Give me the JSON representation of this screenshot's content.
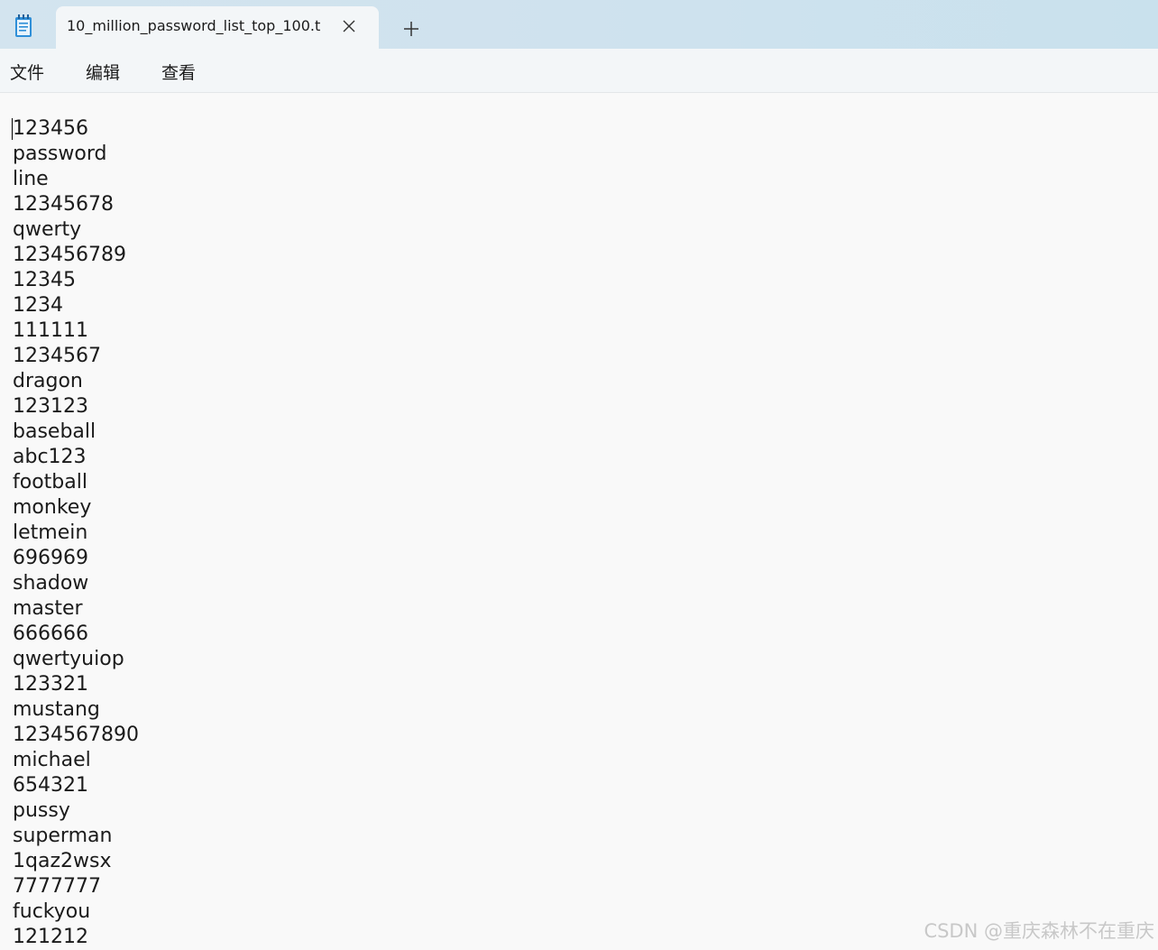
{
  "window": {
    "tab_title": "10_million_password_list_top_100.t",
    "app_icon": "notepad-icon",
    "close_icon": "close-icon",
    "new_tab_icon": "plus-icon"
  },
  "menu": {
    "file": "文件",
    "edit": "编辑",
    "view": "查看"
  },
  "editor": {
    "lines": [
      "123456",
      "password",
      "line",
      "12345678",
      "qwerty",
      "123456789",
      "12345",
      "1234",
      "111111",
      "1234567",
      "dragon",
      "123123",
      "baseball",
      "abc123",
      "football",
      "monkey",
      "letmein",
      "696969",
      "shadow",
      "master",
      "666666",
      "qwertyuiop",
      "123321",
      "mustang",
      "1234567890",
      "michael",
      "654321",
      "pussy",
      "superman",
      "1qaz2wsx",
      "7777777",
      "fuckyou",
      "121212"
    ]
  },
  "watermark": "CSDN @重庆森林不在重庆"
}
